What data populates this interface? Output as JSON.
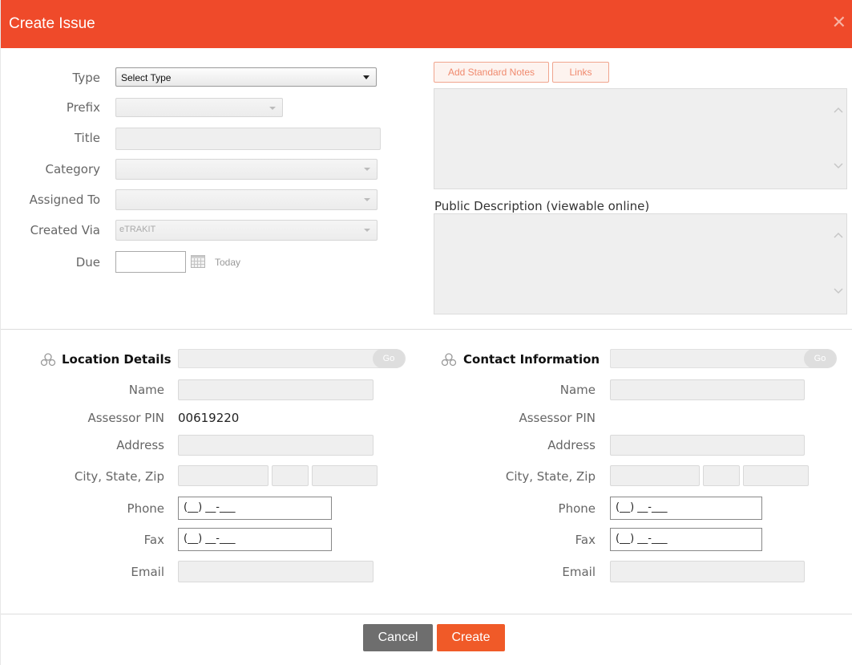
{
  "dialog": {
    "title": "Create Issue",
    "close_icon": "close-icon"
  },
  "issue_form": {
    "type_label": "Type",
    "type_value": "Select Type",
    "prefix_label": "Prefix",
    "title_label": "Title",
    "category_label": "Category",
    "assigned_to_label": "Assigned To",
    "created_via_label": "Created Via",
    "created_via_value": "eTRAKIT",
    "due_label": "Due",
    "due_today_link": "Today"
  },
  "notes": {
    "add_standard_notes_label": "Add Standard Notes",
    "links_label": "Links",
    "public_description_label": "Public Description (viewable online)"
  },
  "location": {
    "heading": "Location Details",
    "go_label": "Go",
    "name_label": "Name",
    "assessor_pin_label": "Assessor PIN",
    "assessor_pin_value": "00619220",
    "address_label": "Address",
    "city_state_zip_label": "City, State, Zip",
    "phone_label": "Phone",
    "phone_value": "(__) __-___",
    "fax_label": "Fax",
    "fax_value": "(__) __-___",
    "email_label": "Email"
  },
  "contact": {
    "heading": "Contact Information",
    "go_label": "Go",
    "name_label": "Name",
    "assessor_pin_label": "Assessor PIN",
    "address_label": "Address",
    "city_state_zip_label": "City, State, Zip",
    "phone_label": "Phone",
    "phone_value": "(__) __-___",
    "fax_label": "Fax",
    "fax_value": "(__) __-___",
    "email_label": "Email"
  },
  "footer": {
    "cancel_label": "Cancel",
    "create_label": "Create"
  },
  "colors": {
    "header": "#ef4a2a",
    "create_button": "#f05a28",
    "cancel_button": "#6e6e6e"
  }
}
